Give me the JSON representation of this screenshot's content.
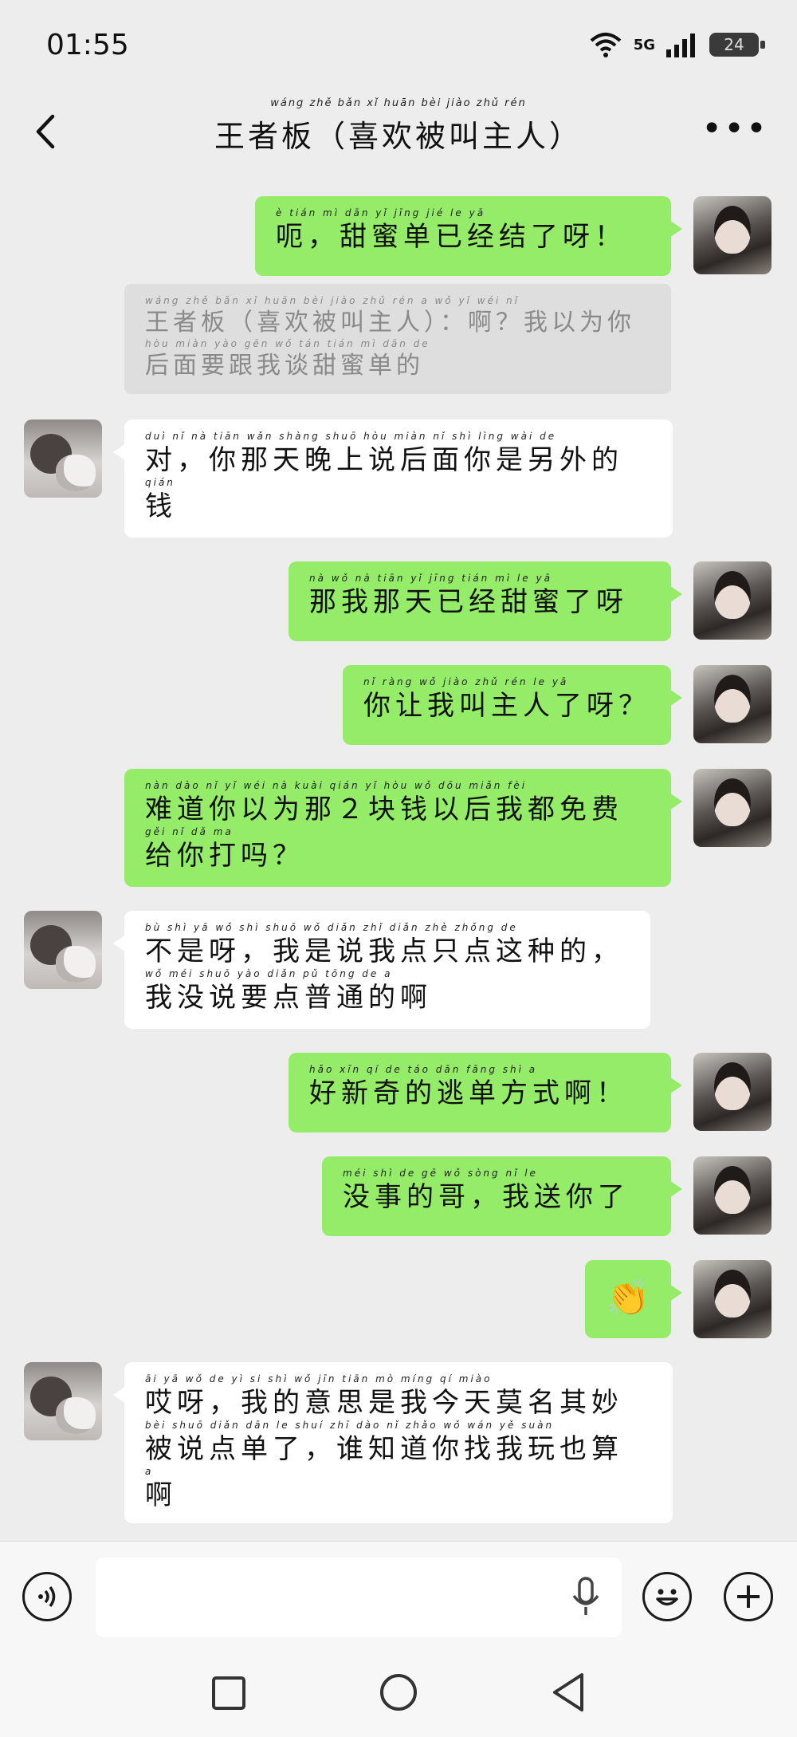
{
  "status_bar": {
    "time": "01:55",
    "network": "5G",
    "battery": "24"
  },
  "header": {
    "title": "王者板（喜欢被叫主人）",
    "title_pinyin": "wáng zhě bǎn   xǐ huān bèi jiào zhǔ rén"
  },
  "messages": [
    {
      "side": "me",
      "pinyin": "è  tián mì dān yǐ jīng jié le yā",
      "text": "呃，甜蜜单已经结了呀！"
    },
    {
      "side": "quote",
      "pinyin1": "wáng zhě bǎn  xǐ huān bèi jiào zhǔ rén     a   wǒ yǐ wéi nǐ",
      "line1": "王者板（喜欢被叫主人）：啊？我以为你",
      "pinyin2": "hòu miàn yào gēn wǒ tán tián mì dān de",
      "line2": "后面要跟我谈甜蜜单的"
    },
    {
      "side": "other",
      "pinyin1": "duì  nǐ nà tiān wǎn shàng shuō hòu miàn nǐ shì lìng wài de",
      "line1": "对，你那天晚上说后面你是另外的",
      "pinyin2": "qián",
      "line2": "钱"
    },
    {
      "side": "me",
      "pinyin": "nà wǒ nà tiān yǐ jīng tián mì le yā",
      "text": "那我那天已经甜蜜了呀"
    },
    {
      "side": "me",
      "pinyin": "nǐ ràng wǒ jiào zhǔ rén le yā",
      "text": "你让我叫主人了呀？"
    },
    {
      "side": "me",
      "pinyin1": "nàn dào nǐ yǐ wéi nà   kuài qián yǐ hòu wǒ dōu miǎn fèi",
      "line1": "难道你以为那２块钱以后我都免费",
      "pinyin2": "gěi nǐ dǎ ma",
      "line2": "给你打吗？"
    },
    {
      "side": "other",
      "pinyin1": "bù shì yā  wǒ shì shuō wǒ diǎn zhǐ diǎn zhè zhǒng de",
      "line1": "不是呀，我是说我点只点这种的，",
      "pinyin2": "wǒ méi shuō yào diǎn pǔ tōng de a",
      "line2": "我没说要点普通的啊"
    },
    {
      "side": "me",
      "pinyin": "hǎo xīn qí de táo dān fāng shì a",
      "text": "好新奇的逃单方式啊！"
    },
    {
      "side": "me",
      "pinyin": "méi shì de gē  wǒ sòng nǐ le",
      "text": "没事的哥，我送你了"
    },
    {
      "side": "me",
      "emoji": "👏"
    },
    {
      "side": "other",
      "pinyin1": "āi yā  wǒ de yì si shì wǒ jīn tiān mò míng qí miào",
      "line1": "哎呀，我的意思是我今天莫名其妙",
      "pinyin2": "bèi shuō diǎn dān le  shuí zhī dào nǐ zhǎo wǒ wán yě suàn",
      "line2": "被说点单了，谁知道你找我玩也算",
      "pinyin3": "a",
      "line3": "啊"
    }
  ],
  "input_bar": {
    "voice_icon": "voice-icon",
    "emoji_icon": "emoji-icon",
    "add_icon": "plus-icon",
    "mic_icon": "mic-icon",
    "input_value": ""
  },
  "nav_bar": {
    "items": [
      "recents-icon",
      "home-icon",
      "back-icon"
    ]
  },
  "colors": {
    "me_bubble": "#95ec69",
    "other_bubble": "#ffffff",
    "background": "#ededed"
  }
}
